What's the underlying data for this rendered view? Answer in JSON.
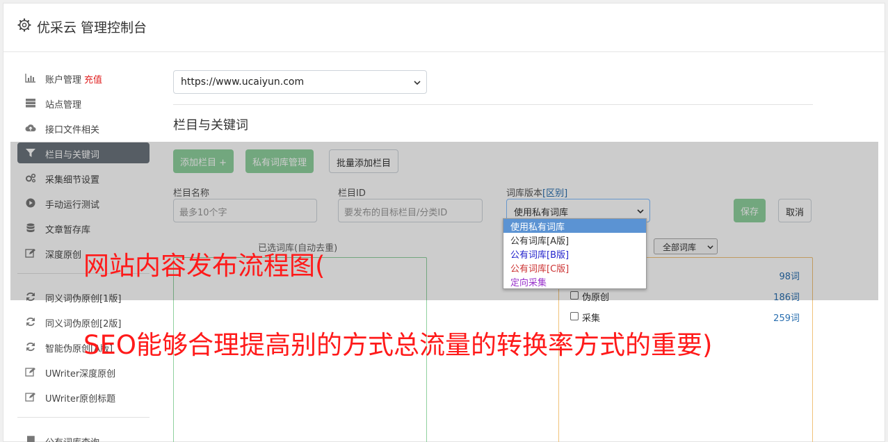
{
  "header": {
    "title": "优采云 管理控制台",
    "icon": "gear-icon"
  },
  "sidebar": {
    "groups": [
      [
        {
          "label": "账户管理",
          "badge": "充值",
          "icon": "bar-chart-icon"
        },
        {
          "label": "站点管理",
          "icon": "server-icon"
        },
        {
          "label": "接口文件相关",
          "icon": "cloud-upload-icon"
        },
        {
          "label": "栏目与关键词",
          "icon": "filter-icon",
          "active": true
        },
        {
          "label": "采集细节设置",
          "icon": "cogs-icon"
        },
        {
          "label": "手动运行测试",
          "icon": "play-circle-icon"
        },
        {
          "label": "文章暂存库",
          "icon": "database-icon"
        },
        {
          "label": "深度原创",
          "icon": "edit-icon"
        }
      ],
      [
        {
          "label": "同义词伪原创[1版]",
          "icon": "refresh-icon"
        },
        {
          "label": "同义词伪原创[2版]",
          "icon": "refresh-icon"
        },
        {
          "label": "智能伪原创[A版]",
          "icon": "refresh-icon"
        },
        {
          "label": "UWriter深度原创",
          "icon": "edit-icon"
        },
        {
          "label": "UWriter原创标题",
          "icon": "edit-icon"
        }
      ],
      [
        {
          "label": "公有词库查询",
          "icon": "book-icon"
        }
      ]
    ]
  },
  "main": {
    "site_select": {
      "value": "https://www.ucaiyun.com"
    },
    "section_title": "栏目与关键词",
    "buttons": {
      "add_column": "添加栏目 +",
      "private_lib": "私有词库管理",
      "batch_add": "批量添加栏目",
      "save": "保存",
      "cancel": "取消"
    },
    "form": {
      "column_name_label": "栏目名称",
      "column_name_placeholder": "最多10个字",
      "column_id_label": "栏目ID",
      "column_id_placeholder": "要发布的目标栏目/分类ID",
      "lib_version_label": "词库版本",
      "lib_version_link": "[区别]",
      "lib_version_value": "使用私有词库"
    },
    "dropdown_options": [
      {
        "label": "使用私有词库",
        "color": "#ffffff",
        "selected": true
      },
      {
        "label": "公有词库[A版]",
        "color": "#333333"
      },
      {
        "label": "公有词库[B版]",
        "color": "#2222cc"
      },
      {
        "label": "公有词库[C版]",
        "color": "#cc3333"
      },
      {
        "label": "定向采集",
        "color": "#9933cc"
      }
    ],
    "panel_caption": "已选词库(自动去重)",
    "lib_filter": {
      "value": "全部词库"
    },
    "libraries": [
      {
        "name": "",
        "count": "98词"
      },
      {
        "name": "伪原创",
        "count": "186词"
      },
      {
        "name": "采集",
        "count": "259词"
      }
    ]
  },
  "watermark": {
    "line1": "网站内容发布流程图(",
    "line2": "SEO能够合理提高别的方式总流量的转换率方式的重要)"
  }
}
